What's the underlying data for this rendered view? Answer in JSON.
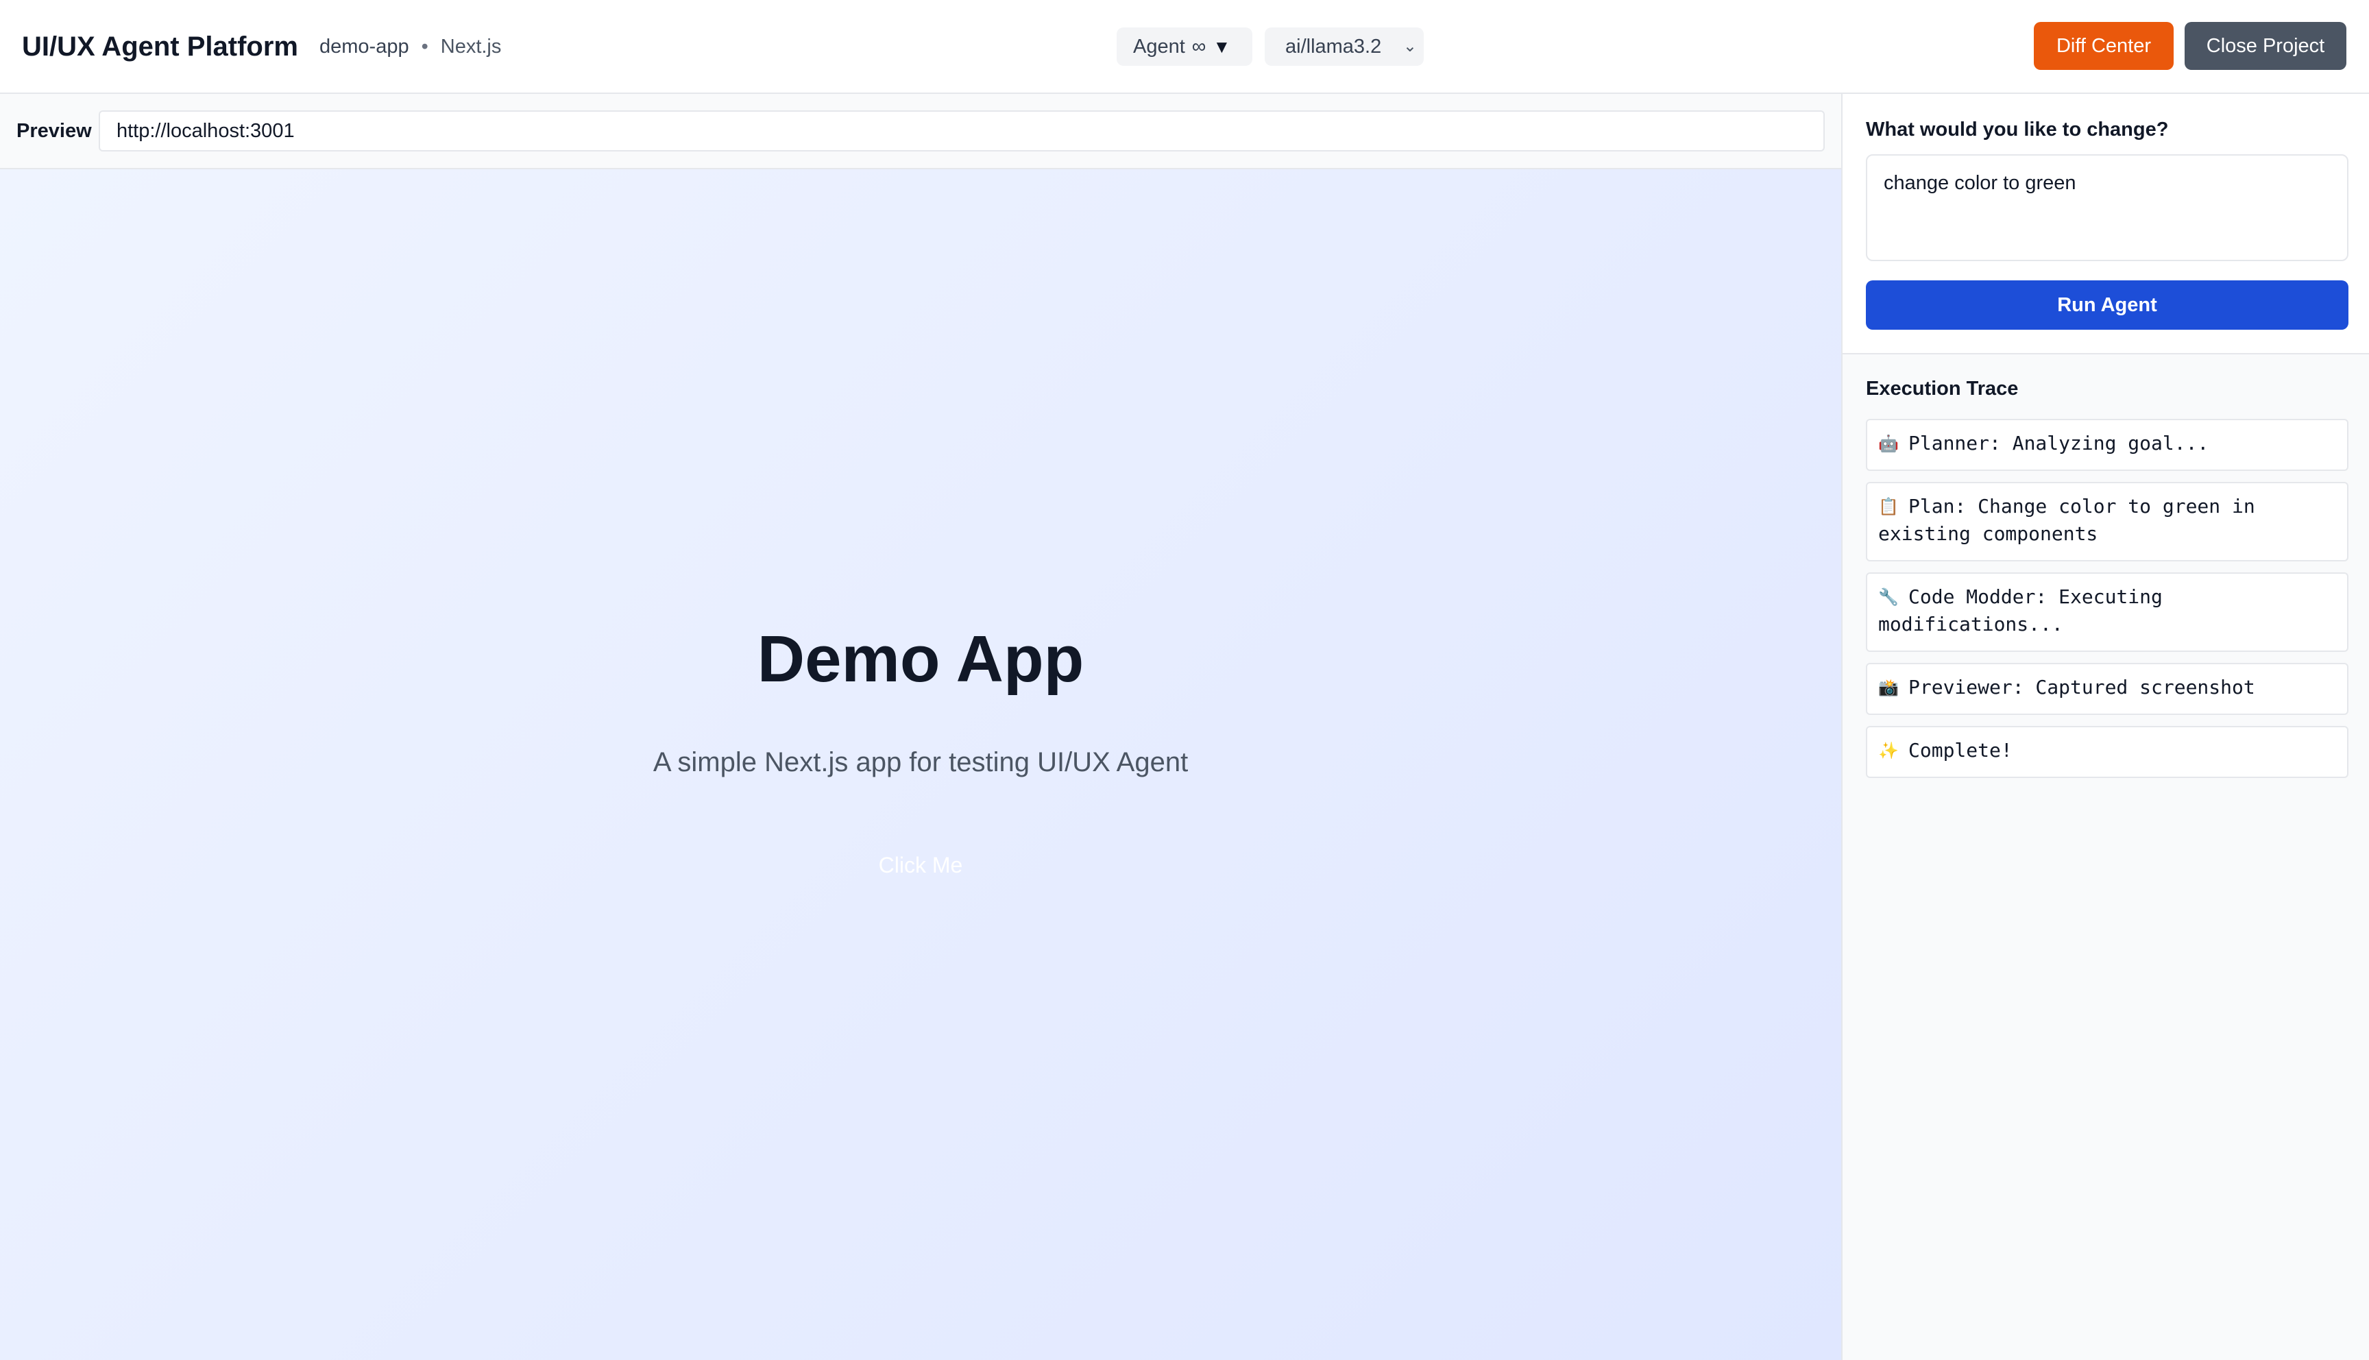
{
  "header": {
    "app_title": "UI/UX Agent Platform",
    "project_name": "demo-app",
    "separator": "•",
    "framework": "Next.js",
    "agent_select": {
      "label": "Agent",
      "infinity": "∞",
      "caret": "▼"
    },
    "model_select": {
      "value": "ai/llama3.2",
      "chevron": "⌄"
    },
    "diff_center_label": "Diff Center",
    "close_project_label": "Close Project"
  },
  "preview": {
    "label": "Preview",
    "url": "http://localhost:3001",
    "page": {
      "title": "Demo App",
      "subtitle": "A simple Next.js app for testing UI/UX Agent",
      "button_label": "Click Me"
    }
  },
  "panel": {
    "goal_label": "What would you like to change?",
    "goal_value": "change color to green",
    "run_label": "Run Agent",
    "trace_title": "Execution Trace",
    "trace": [
      {
        "icon": "🤖",
        "icon_name": "robot-icon",
        "text": "Planner: Analyzing goal..."
      },
      {
        "icon": "📋",
        "icon_name": "clipboard-icon",
        "text": "Plan: Change color to green in existing components"
      },
      {
        "icon": "🔧",
        "icon_name": "wrench-icon",
        "text": "Code Modder: Executing modifications..."
      },
      {
        "icon": "📸",
        "icon_name": "camera-icon",
        "text": "Previewer: Captured screenshot"
      },
      {
        "icon": "✨",
        "icon_name": "sparkles-icon",
        "text": "Complete!"
      }
    ]
  },
  "colors": {
    "accent_orange": "#ea580c",
    "accent_blue": "#1d4ed8",
    "neutral_button": "#4b5563",
    "preview_bg_start": "#eff4ff",
    "preview_bg_end": "#e0e7ff"
  }
}
